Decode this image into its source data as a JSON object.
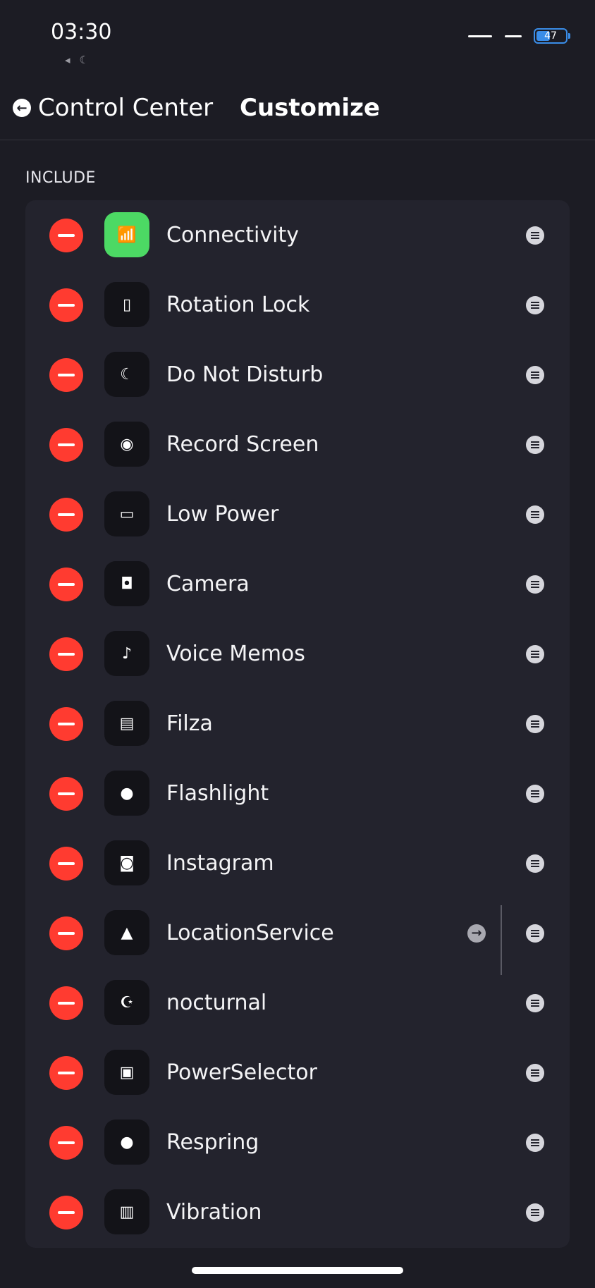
{
  "status_bar": {
    "time": "03:30",
    "status_icons": [
      {
        "name": "location-muted-icon",
        "glyph": "◂"
      },
      {
        "name": "moon-icon",
        "glyph": "☾"
      }
    ],
    "battery_level": 47,
    "battery_text": "47",
    "accent_color": "#3a8de8"
  },
  "nav": {
    "back_label": "Control Center",
    "back_icon": "arrow-left-circle-icon",
    "title": "Customize"
  },
  "section": {
    "header": "INCLUDE"
  },
  "items": [
    {
      "label": "Connectivity",
      "icon": "antenna-icon",
      "glyph": "📶",
      "icon_bg": "#4cd964"
    },
    {
      "label": "Rotation Lock",
      "icon": "rotation-lock-icon",
      "glyph": "▯"
    },
    {
      "label": "Do Not Disturb",
      "icon": "moon-icon",
      "glyph": "☾"
    },
    {
      "label": "Record Screen",
      "icon": "record-icon",
      "glyph": "◉"
    },
    {
      "label": "Low Power",
      "icon": "battery-icon",
      "glyph": "▭"
    },
    {
      "label": "Camera",
      "icon": "camera-icon",
      "glyph": "◘"
    },
    {
      "label": "Voice Memos",
      "icon": "microphone-icon",
      "glyph": "♪"
    },
    {
      "label": "Filza",
      "icon": "folder-icon",
      "glyph": "▤"
    },
    {
      "label": "Flashlight",
      "icon": "flashlight-icon",
      "glyph": "●"
    },
    {
      "label": "Instagram",
      "icon": "instagram-icon",
      "glyph": "◙"
    },
    {
      "label": "LocationService",
      "icon": "location-arrow-icon",
      "glyph": "▲",
      "has_detail": true
    },
    {
      "label": "nocturnal",
      "icon": "moon-star-icon",
      "glyph": "☪"
    },
    {
      "label": "PowerSelector",
      "icon": "power-selector-icon",
      "glyph": "▣"
    },
    {
      "label": "Respring",
      "icon": "flame-icon",
      "glyph": "●"
    },
    {
      "label": "Vibration",
      "icon": "vibration-icon",
      "glyph": "▥"
    }
  ],
  "colors": {
    "background": "#1c1c24",
    "card": "#23232d",
    "remove": "#ff3b30"
  }
}
